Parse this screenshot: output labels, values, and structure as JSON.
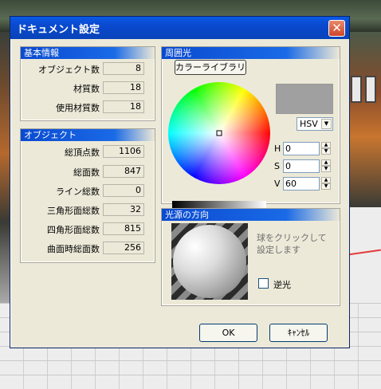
{
  "dialog": {
    "title": "ドキュメント設定",
    "close_glyph": "✕"
  },
  "basic_info": {
    "header": "基本情報",
    "rows": [
      {
        "label": "オブジェクト数",
        "value": "8"
      },
      {
        "label": "材質数",
        "value": "18"
      },
      {
        "label": "使用材質数",
        "value": "18"
      }
    ]
  },
  "object_info": {
    "header": "オブジェクト",
    "rows": [
      {
        "label": "総頂点数",
        "value": "1106"
      },
      {
        "label": "総面数",
        "value": "847"
      },
      {
        "label": "ライン総数",
        "value": "0"
      },
      {
        "label": "三角形面総数",
        "value": "32"
      },
      {
        "label": "四角形面総数",
        "value": "815"
      },
      {
        "label": "曲面時総面数",
        "value": "256"
      }
    ]
  },
  "ambient": {
    "header": "周囲光",
    "color_library_button": "カラーライブラリ",
    "mode_select": "HSV",
    "preview_color": "#a0a0a0",
    "h_label": "H",
    "h_value": "0",
    "s_label": "S",
    "s_value": "0",
    "v_label": "V",
    "v_value": "60",
    "v_level": 0.6
  },
  "light_direction": {
    "header": "光源の方向",
    "hint": "球をクリックして設定します",
    "reverse_label": "逆光",
    "reverse_checked": false
  },
  "buttons": {
    "ok": "OK",
    "cancel": "ｷｬﾝｾﾙ"
  },
  "colors": {
    "title_bar": "#0a4ad0",
    "dialog_bg": "#ece9d8",
    "close_button": "#d0452a"
  }
}
